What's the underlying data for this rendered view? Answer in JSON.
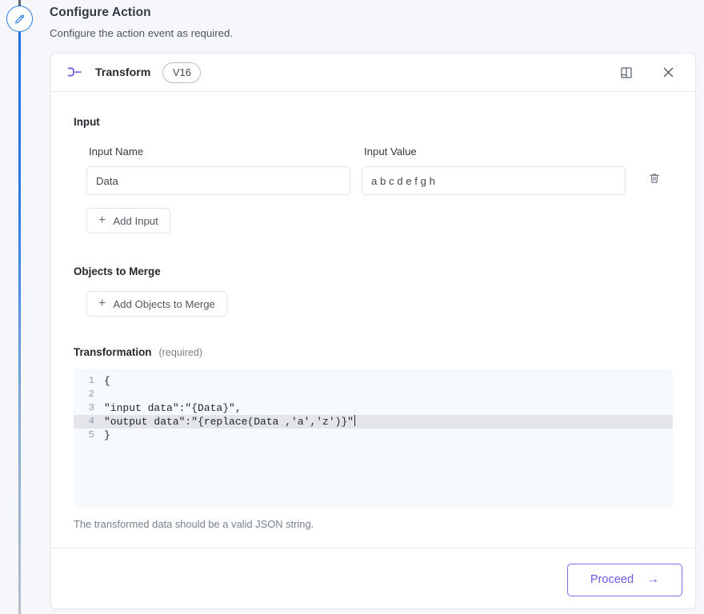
{
  "page": {
    "title": "Configure Action",
    "subtitle": "Configure the action event as required."
  },
  "rail": {
    "node_icon": "pencil-icon"
  },
  "card": {
    "header": {
      "icon": "transform-icon",
      "title": "Transform",
      "version_badge": "V16",
      "docs_icon": "book-icon",
      "close_icon": "close-icon"
    },
    "input_section": {
      "label": "Input",
      "columns": {
        "name_label": "Input Name",
        "value_label": "Input Value"
      },
      "rows": [
        {
          "name_value": "Data",
          "name_placeholder": "Input Name",
          "value_value": "a b c d e f g h",
          "value_placeholder": "Input Value",
          "delete_icon": "trash-icon"
        }
      ],
      "add_button": "Add Input"
    },
    "merge_section": {
      "label": "Objects to Merge",
      "add_button": "Add Objects to Merge"
    },
    "transformation": {
      "label": "Transformation",
      "required_note": "(required)",
      "active_line": 4,
      "lines": [
        {
          "number": "1",
          "code": "{"
        },
        {
          "number": "2",
          "code": ""
        },
        {
          "number": "3",
          "code": "\"input data\":\"{Data}\","
        },
        {
          "number": "4",
          "code": "\"output data\":\"{replace(Data ,'a','z')}\""
        },
        {
          "number": "5",
          "code": "}"
        }
      ],
      "hint": "The transformed data should be a valid JSON string."
    },
    "footer": {
      "proceed_label": "Proceed",
      "proceed_arrow": "→"
    }
  },
  "colors": {
    "page_background": "#f6f7fa",
    "accent_purple": "#6a5bea",
    "rail_blue": "#1f6fe0",
    "editor_background": "#f6fafd",
    "active_line": "#e3e5e8"
  }
}
